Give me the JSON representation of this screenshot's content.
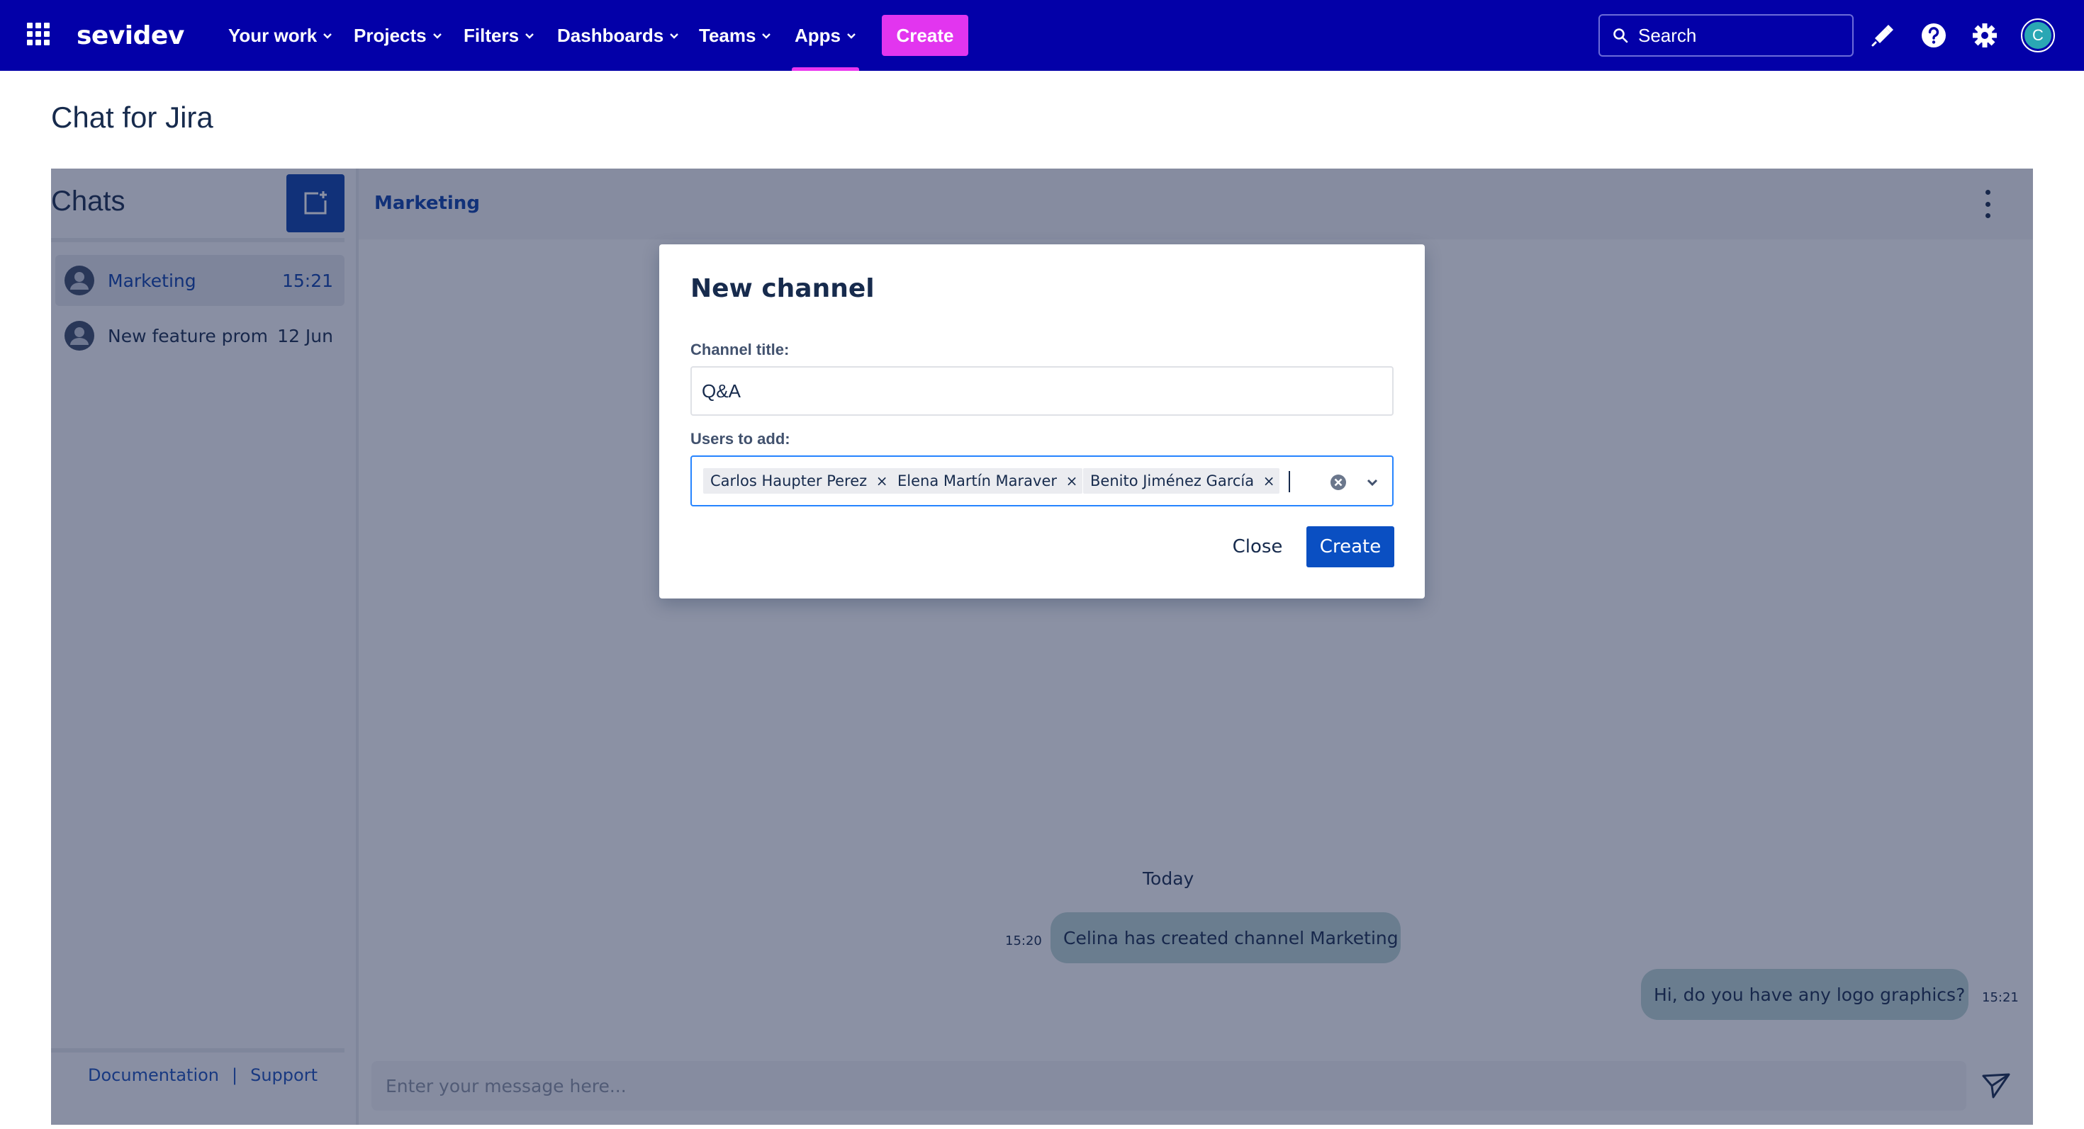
{
  "topnav": {
    "logo_text": "sevidev",
    "items": [
      {
        "label": "Your work"
      },
      {
        "label": "Projects"
      },
      {
        "label": "Filters"
      },
      {
        "label": "Dashboards"
      },
      {
        "label": "Teams"
      },
      {
        "label": "Apps",
        "active": true
      }
    ],
    "create_label": "Create",
    "search_placeholder": "Search",
    "user_initial": "C",
    "colors": {
      "bar": "#0300a8",
      "create": "#e235ef",
      "avatar": "#2aa7b4"
    }
  },
  "page": {
    "title": "Chat for Jira"
  },
  "sidebar": {
    "title": "Chats",
    "chats": [
      {
        "name": "Marketing",
        "time": "15:21",
        "selected": true
      },
      {
        "name": "New feature prom",
        "time": "12 Jun",
        "selected": false
      }
    ],
    "footer": {
      "documentation": "Documentation",
      "separator": "|",
      "support": "Support"
    }
  },
  "conversation": {
    "channel_name": "Marketing",
    "day_label": "Today",
    "messages": [
      {
        "text": "Celina has created channel Marketing",
        "time": "15:20",
        "side": "left"
      },
      {
        "text": "Hi, do you have any logo graphics?",
        "time": "15:21",
        "side": "right"
      }
    ],
    "composer_placeholder": "Enter your message here..."
  },
  "modal": {
    "title": "New channel",
    "channel_title_label": "Channel title:",
    "channel_title_value": "Q&A",
    "users_label": "Users to add:",
    "users": [
      "Carlos Haupter Perez",
      "Elena Martín Maraver",
      "Benito Jiménez García"
    ],
    "close_label": "Close",
    "create_label": "Create",
    "colors": {
      "primary": "#0a4fc2",
      "focus": "#2684ff"
    }
  }
}
